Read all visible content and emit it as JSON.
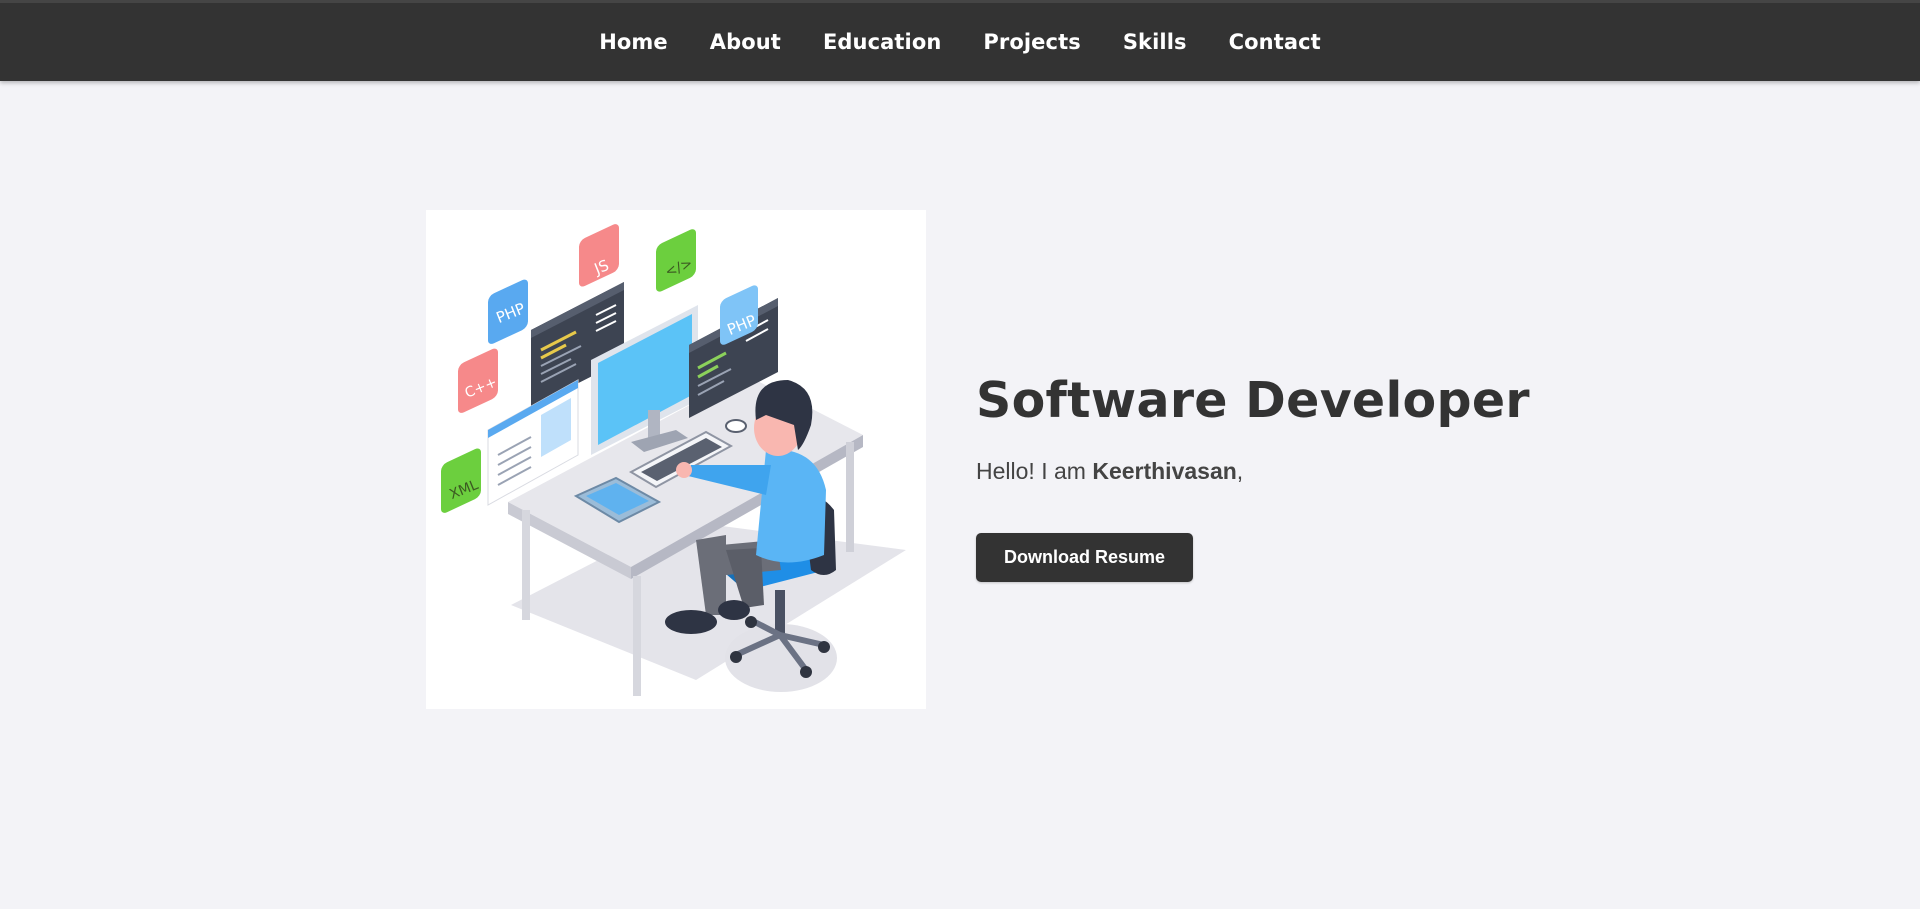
{
  "nav": {
    "items": [
      {
        "label": "Home"
      },
      {
        "label": "About"
      },
      {
        "label": "Education"
      },
      {
        "label": "Projects"
      },
      {
        "label": "Skills"
      },
      {
        "label": "Contact"
      }
    ]
  },
  "hero": {
    "title": "Software Developer",
    "greeting_prefix": "Hello! I am ",
    "name": "Keerthivasan",
    "greeting_suffix": ",",
    "button_label": "Download Resume",
    "illustration_tags": [
      "PHP",
      "JS",
      "</>",
      "C++",
      "PHP",
      "XML"
    ]
  },
  "colors": {
    "nav_bg": "#333333",
    "page_bg": "#f3f3f7",
    "button_bg": "#333333",
    "text_dark": "#333333"
  }
}
